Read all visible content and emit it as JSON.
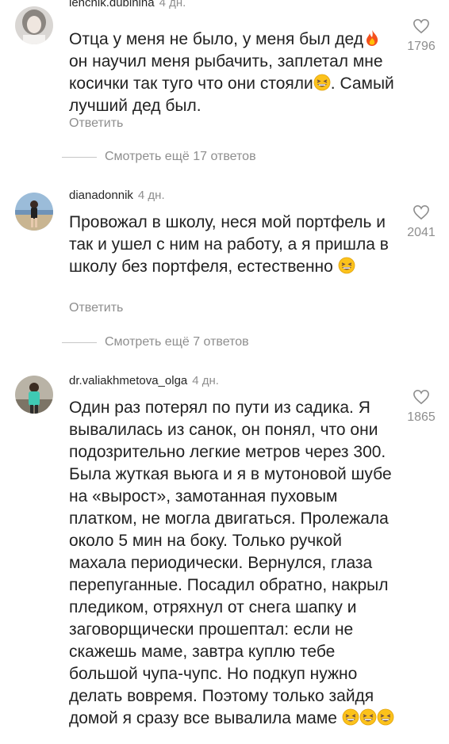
{
  "comments": [
    {
      "username": "lencnik.dubinina",
      "time": "4 дн.",
      "text_parts": [
        "Отца у меня не было, у меня был дед",
        "он научил меня рыбачить, заплетал мне косички так туго что они стояли",
        ". Самый лучший дед был."
      ],
      "likes": "1796",
      "reply_label": "Ответить",
      "more_replies": "Смотреть ещё 17 ответов"
    },
    {
      "username": "dianadonnik",
      "time": "4 дн.",
      "text": "Провожал в школу, неся мой портфель и так и ушел с ним на работу, а я пришла в школу без портфеля, естественно",
      "likes": "2041",
      "reply_label": "Ответить",
      "more_replies": "Смотреть ещё 7 ответов"
    },
    {
      "username": "dr.valiakhmetova_olga",
      "time": "4 дн.",
      "text": "Один раз потерял по пути из садика. Я вывалилась из санок, он понял, что они подозрительно легкие метров через 300. Была жуткая вьюга и я в мутоновой шубе на «вырост», замотанная пуховым платком, не могла двигаться. Пролежала около 5 мин на боку. Только ручкой махала периодически. Вернулся, глаза перепуганные. Посадил обратно, накрыл пледиком, отряхнул от снега шапку и заговорщически прошептал: если не скажешь маме, завтра куплю тебе большой чупа-чупс. Но подкуп нужно делать вовремя. Поэтому только зайдя домой я сразу все вывалила маме",
      "likes": "1865"
    }
  ],
  "icons": {
    "like": "heart-outline-icon",
    "fire": "fire-emoji",
    "laugh": "grinning-squinting-emoji"
  },
  "colors": {
    "text": "#222222",
    "muted": "#8e8e8e",
    "divider": "#c7c7c7",
    "background": "#ffffff"
  }
}
